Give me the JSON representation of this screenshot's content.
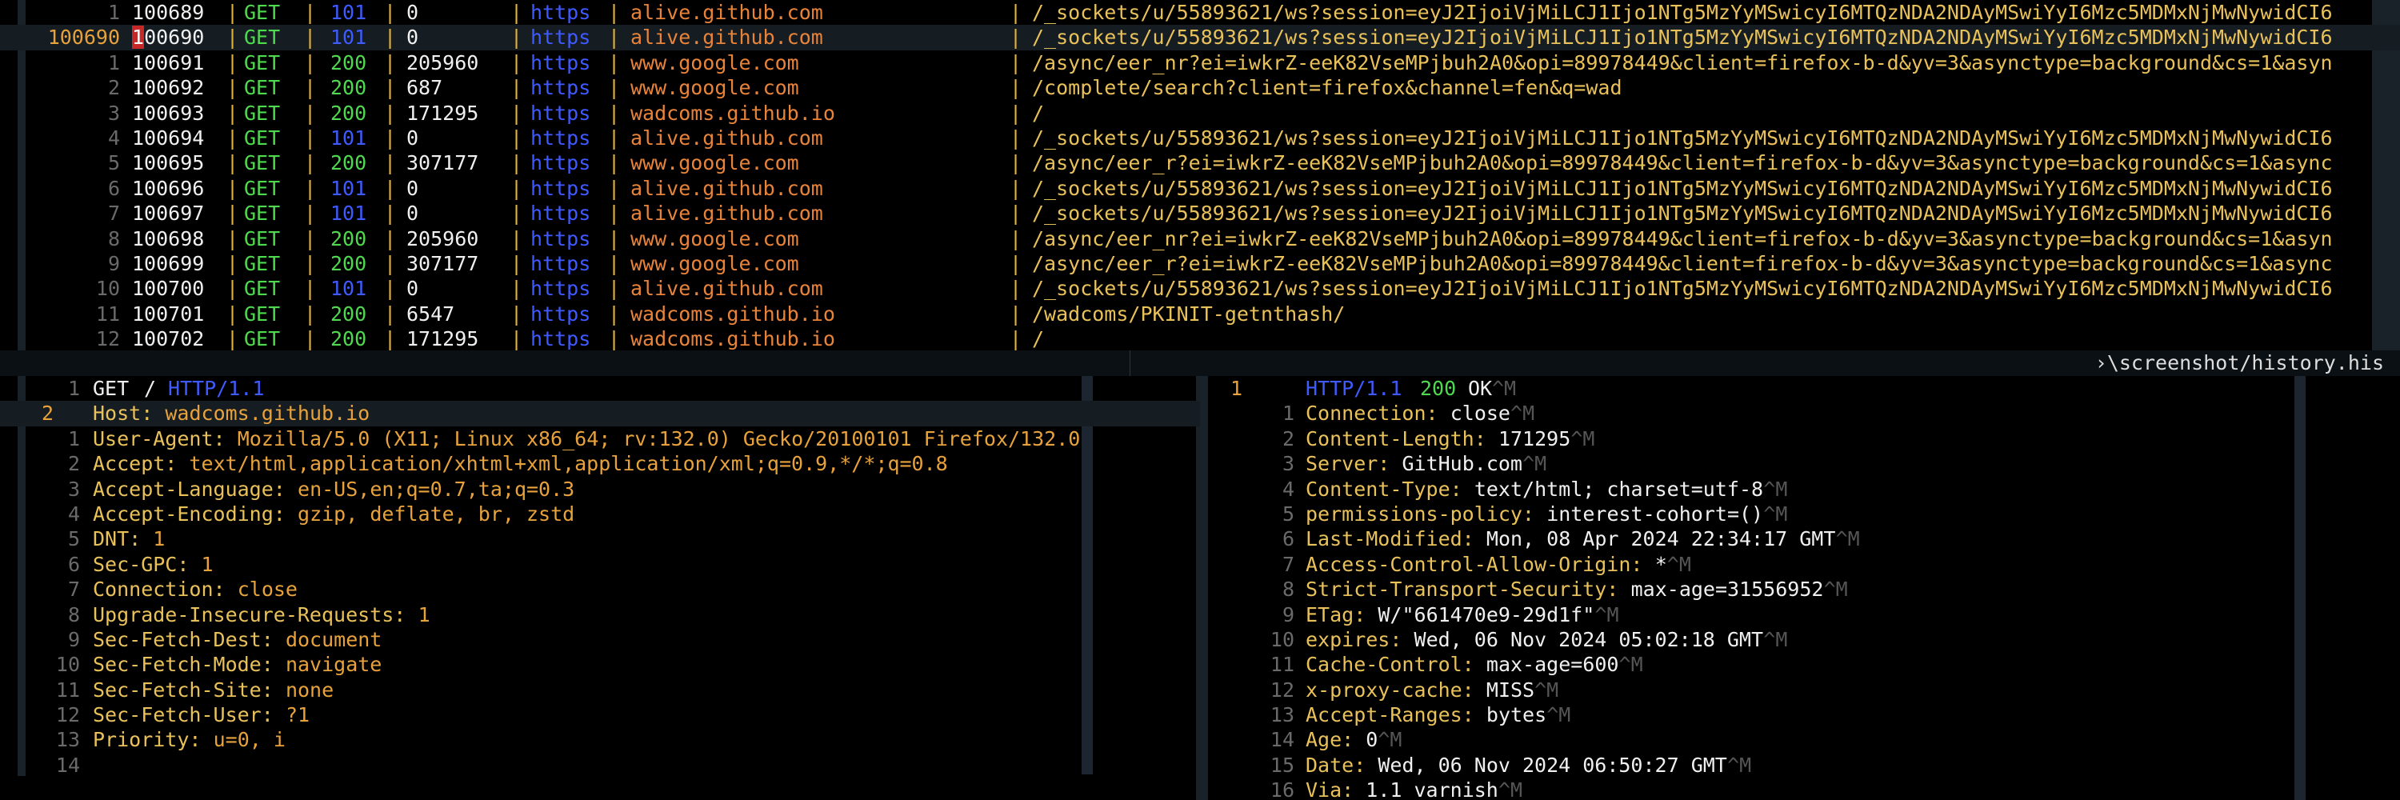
{
  "history": {
    "current_gutter": "100690",
    "rows": [
      {
        "gutter": "1",
        "id": "100689",
        "method": "GET",
        "status": "101",
        "size": "0",
        "scheme": "https",
        "host": "alive.github.com",
        "path": "/_sockets/u/55893621/ws?session=eyJ2IjoiVjMiLCJ1Ijo1NTg5MzYyMSwicyI6MTQzNDA2NDAyMSwiYyI6Mzc5MDMxNjMwNywidCI6"
      },
      {
        "gutter": "",
        "id": "100690",
        "method": "GET",
        "status": "101",
        "size": "0",
        "scheme": "https",
        "host": "alive.github.com",
        "path": "/_sockets/u/55893621/ws?session=eyJ2IjoiVjMiLCJ1Ijo1NTg5MzYyMSwicyI6MTQzNDA2NDAyMSwiYyI6Mzc5MDMxNjMwNywidCI6"
      },
      {
        "gutter": "1",
        "id": "100691",
        "method": "GET",
        "status": "200",
        "size": "205960",
        "scheme": "https",
        "host": "www.google.com",
        "path": "/async/eer_nr?ei=iwkrZ-eeK82VseMPjbuh2A0&opi=89978449&client=firefox-b-d&yv=3&asynctype=background&cs=1&asyn"
      },
      {
        "gutter": "2",
        "id": "100692",
        "method": "GET",
        "status": "200",
        "size": "687",
        "scheme": "https",
        "host": "www.google.com",
        "path": "/complete/search?client=firefox&channel=fen&q=wad"
      },
      {
        "gutter": "3",
        "id": "100693",
        "method": "GET",
        "status": "200",
        "size": "171295",
        "scheme": "https",
        "host": "wadcoms.github.io",
        "path": "/"
      },
      {
        "gutter": "4",
        "id": "100694",
        "method": "GET",
        "status": "101",
        "size": "0",
        "scheme": "https",
        "host": "alive.github.com",
        "path": "/_sockets/u/55893621/ws?session=eyJ2IjoiVjMiLCJ1Ijo1NTg5MzYyMSwicyI6MTQzNDA2NDAyMSwiYyI6Mzc5MDMxNjMwNywidCI6"
      },
      {
        "gutter": "5",
        "id": "100695",
        "method": "GET",
        "status": "200",
        "size": "307177",
        "scheme": "https",
        "host": "www.google.com",
        "path": "/async/eer_r?ei=iwkrZ-eeK82VseMPjbuh2A0&opi=89978449&client=firefox-b-d&yv=3&asynctype=background&cs=1&async"
      },
      {
        "gutter": "6",
        "id": "100696",
        "method": "GET",
        "status": "101",
        "size": "0",
        "scheme": "https",
        "host": "alive.github.com",
        "path": "/_sockets/u/55893621/ws?session=eyJ2IjoiVjMiLCJ1Ijo1NTg5MzYyMSwicyI6MTQzNDA2NDAyMSwiYyI6Mzc5MDMxNjMwNywidCI6"
      },
      {
        "gutter": "7",
        "id": "100697",
        "method": "GET",
        "status": "101",
        "size": "0",
        "scheme": "https",
        "host": "alive.github.com",
        "path": "/_sockets/u/55893621/ws?session=eyJ2IjoiVjMiLCJ1Ijo1NTg5MzYyMSwicyI6MTQzNDA2NDAyMSwiYyI6Mzc5MDMxNjMwNywidCI6"
      },
      {
        "gutter": "8",
        "id": "100698",
        "method": "GET",
        "status": "200",
        "size": "205960",
        "scheme": "https",
        "host": "www.google.com",
        "path": "/async/eer_nr?ei=iwkrZ-eeK82VseMPjbuh2A0&opi=89978449&client=firefox-b-d&yv=3&asynctype=background&cs=1&asyn"
      },
      {
        "gutter": "9",
        "id": "100699",
        "method": "GET",
        "status": "200",
        "size": "307177",
        "scheme": "https",
        "host": "www.google.com",
        "path": "/async/eer_r?ei=iwkrZ-eeK82VseMPjbuh2A0&opi=89978449&client=firefox-b-d&yv=3&asynctype=background&cs=1&async"
      },
      {
        "gutter": "10",
        "id": "100700",
        "method": "GET",
        "status": "101",
        "size": "0",
        "scheme": "https",
        "host": "alive.github.com",
        "path": "/_sockets/u/55893621/ws?session=eyJ2IjoiVjMiLCJ1Ijo1NTg5MzYyMSwicyI6MTQzNDA2NDAyMSwiYyI6Mzc5MDMxNjMwNywidCI6"
      },
      {
        "gutter": "11",
        "id": "100701",
        "method": "GET",
        "status": "200",
        "size": "6547",
        "scheme": "https",
        "host": "wadcoms.github.io",
        "path": "/wadcoms/PKINIT-getnthash/"
      },
      {
        "gutter": "12",
        "id": "100702",
        "method": "GET",
        "status": "200",
        "size": "171295",
        "scheme": "https",
        "host": "wadcoms.github.io",
        "path": "/"
      }
    ],
    "separator": "|"
  },
  "statusline": {
    "path": "›\\screenshot/history.his"
  },
  "request": {
    "request_line": {
      "gutter": "1",
      "method": "GET",
      "target": "/",
      "version": "HTTP/1.1"
    },
    "headers": [
      {
        "gutter": "2",
        "name": "Host:",
        "value": "wadcoms.github.io"
      },
      {
        "gutter": "1",
        "name": "User-Agent:",
        "value": "Mozilla/5.0 (X11; Linux x86_64; rv:132.0) Gecko/20100101 Firefox/132.0"
      },
      {
        "gutter": "2",
        "name": "Accept:",
        "value": "text/html,application/xhtml+xml,application/xml;q=0.9,*/*;q=0.8"
      },
      {
        "gutter": "3",
        "name": "Accept-Language:",
        "value": "en-US,en;q=0.7,ta;q=0.3"
      },
      {
        "gutter": "4",
        "name": "Accept-Encoding:",
        "value": "gzip, deflate, br, zstd"
      },
      {
        "gutter": "5",
        "name": "DNT:",
        "value": "1"
      },
      {
        "gutter": "6",
        "name": "Sec-GPC:",
        "value": "1"
      },
      {
        "gutter": "7",
        "name": "Connection:",
        "value": "close"
      },
      {
        "gutter": "8",
        "name": "Upgrade-Insecure-Requests:",
        "value": "1"
      },
      {
        "gutter": "9",
        "name": "Sec-Fetch-Dest:",
        "value": "document"
      },
      {
        "gutter": "10",
        "name": "Sec-Fetch-Mode:",
        "value": "navigate"
      },
      {
        "gutter": "11",
        "name": "Sec-Fetch-Site:",
        "value": "none"
      },
      {
        "gutter": "12",
        "name": "Sec-Fetch-User:",
        "value": "?1"
      },
      {
        "gutter": "13",
        "name": "Priority:",
        "value": "u=0, i"
      }
    ],
    "trailing_gutter": "14"
  },
  "response": {
    "status_line": {
      "gutter": "1",
      "version": "HTTP/1.1",
      "code": "200",
      "reason": "OK",
      "ctrl": "^M"
    },
    "headers": [
      {
        "gutter": "1",
        "name": "Connection:",
        "value": "close",
        "ctrl": "^M"
      },
      {
        "gutter": "2",
        "name": "Content-Length:",
        "value": "171295",
        "ctrl": "^M"
      },
      {
        "gutter": "3",
        "name": "Server:",
        "value": "GitHub.com",
        "ctrl": "^M"
      },
      {
        "gutter": "4",
        "name": "Content-Type:",
        "value": "text/html; charset=utf-8",
        "ctrl": "^M"
      },
      {
        "gutter": "5",
        "name": "permissions-policy:",
        "value": "interest-cohort=()",
        "ctrl": "^M"
      },
      {
        "gutter": "6",
        "name": "Last-Modified:",
        "value": "Mon, 08 Apr 2024 22:34:17 GMT",
        "ctrl": "^M"
      },
      {
        "gutter": "7",
        "name": "Access-Control-Allow-Origin:",
        "value": "*",
        "ctrl": "^M"
      },
      {
        "gutter": "8",
        "name": "Strict-Transport-Security:",
        "value": "max-age=31556952",
        "ctrl": "^M"
      },
      {
        "gutter": "9",
        "name": "ETag:",
        "value": "W/\"661470e9-29d1f\"",
        "ctrl": "^M"
      },
      {
        "gutter": "10",
        "name": "expires:",
        "value": "Wed, 06 Nov 2024 05:02:18 GMT",
        "ctrl": "^M"
      },
      {
        "gutter": "11",
        "name": "Cache-Control:",
        "value": "max-age=600",
        "ctrl": "^M"
      },
      {
        "gutter": "12",
        "name": "x-proxy-cache:",
        "value": "MISS",
        "ctrl": "^M"
      },
      {
        "gutter": "13",
        "name": "Accept-Ranges:",
        "value": "bytes",
        "ctrl": "^M"
      },
      {
        "gutter": "14",
        "name": "Age:",
        "value": "0",
        "ctrl": "^M"
      },
      {
        "gutter": "15",
        "name": "Date:",
        "value": "Wed, 06 Nov 2024 06:50:27 GMT",
        "ctrl": "^M"
      },
      {
        "gutter": "16",
        "name": "Via:",
        "value": "1.1 varnish",
        "ctrl": "^M"
      }
    ]
  },
  "colors": {
    "background": "#000000",
    "method": "#4fd94f",
    "status_101": "#3f5bff",
    "status_200": "#4fd94f",
    "host": "#e8833a",
    "path": "#e9c15a",
    "header_name": "#e9c15a",
    "header_value": "#e7a23c",
    "separator": "#e0b03a"
  }
}
